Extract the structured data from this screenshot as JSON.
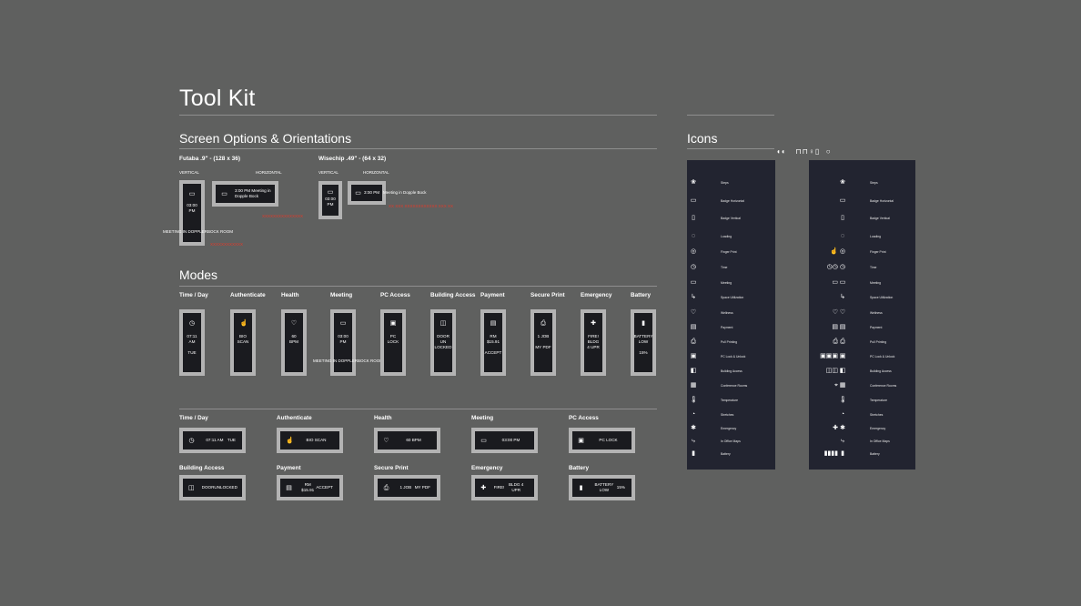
{
  "title": "Tool Kit",
  "screen_options": {
    "heading": "Screen Options & Orientations",
    "futaba": {
      "name": "Futaba .9\" - (128 x 36)",
      "vertical_label": "VERTICAL",
      "horizontal_label": "HORIZONTAL",
      "vertical_text": "03:00 PM",
      "overflow_text": "MEETING IN DOPPLERBOCK ROOM",
      "horizontal_text": "3:00 PM Meeting in Dopple Bock",
      "red_note_v": "XXXXXXXXXXXX",
      "red_note_h": "XXXXXXXXXXXXXXX"
    },
    "wisechip": {
      "name": "Wisechip .49\" - (64 x 32)",
      "vertical_label": "VERTICAL",
      "horizontal_label": "HORIZONTAL",
      "vertical_text": "03:00 PM",
      "horizontal_text": "3:00 PM",
      "overflow_text": "Meeting in Dopple Bock",
      "red_note_h": "XX XXX XXXXXXXXXXXX XXX XX"
    }
  },
  "modes": {
    "heading": "Modes",
    "vertical": [
      {
        "label": "Time / Day",
        "icon": "clock-icon",
        "glyph": "◷",
        "lines": [
          "07:11",
          "AM",
          "",
          "TUE"
        ]
      },
      {
        "label": "Authenticate",
        "icon": "finger-touch-icon",
        "glyph": "☝",
        "lines": [
          "BIO",
          "SCAN"
        ]
      },
      {
        "label": "Health",
        "icon": "heart-pulse-icon",
        "glyph": "♡",
        "lines": [
          "60",
          "BPM"
        ]
      },
      {
        "label": "Meeting",
        "icon": "calendar-icon",
        "glyph": "▭",
        "lines": [
          "03:00",
          "PM"
        ],
        "overflow": "MEETING IN DOPPLERBOCK ROOM"
      },
      {
        "label": "PC Access",
        "icon": "laptop-icon",
        "glyph": "▣",
        "lines": [
          "PC",
          "LOCK"
        ]
      },
      {
        "label": "Building Access",
        "icon": "door-icon",
        "glyph": "◫",
        "lines": [
          "DOOR",
          "UN",
          "LOCKED"
        ]
      },
      {
        "label": "Payment",
        "icon": "card-icon",
        "glyph": "▤",
        "lines": [
          "RM",
          "$15.91",
          "",
          "ACCEPT"
        ]
      },
      {
        "label": "Secure Print",
        "icon": "printer-icon",
        "glyph": "⎙",
        "lines": [
          "1 JOB",
          "",
          "MY PDF"
        ]
      },
      {
        "label": "Emergency",
        "icon": "first-aid-icon",
        "glyph": "✚",
        "lines": [
          "FIRE!",
          "BLDG",
          "4 UPR"
        ]
      },
      {
        "label": "Battery",
        "icon": "battery-icon",
        "glyph": "▮",
        "lines": [
          "BATTERY",
          "LOW",
          "",
          "15%"
        ]
      }
    ],
    "horizontal": [
      {
        "label": "Time / Day",
        "icon": "clock-icon",
        "glyph": "◷",
        "t1": "07:11 AM",
        "t2": "TUE"
      },
      {
        "label": "Authenticate",
        "icon": "finger-touch-icon",
        "glyph": "☝",
        "t1": "BIO SCAN",
        "t2": ""
      },
      {
        "label": "Health",
        "icon": "heart-pulse-icon",
        "glyph": "♡",
        "t1": "60 BPM",
        "t2": ""
      },
      {
        "label": "Meeting",
        "icon": "calendar-icon",
        "glyph": "▭",
        "t1": "03:00 PM",
        "t2": ""
      },
      {
        "label": "PC Access",
        "icon": "laptop-icon",
        "glyph": "▣",
        "t1": "PC LOCK",
        "t2": ""
      },
      {
        "label": "Building Access",
        "icon": "door-icon",
        "glyph": "◫",
        "t1": "DOOR",
        "t2": "UNLOCKED"
      },
      {
        "label": "Payment",
        "icon": "card-icon",
        "glyph": "▤",
        "t1": "RM $15.91",
        "t2": "ACCEPT"
      },
      {
        "label": "Secure Print",
        "icon": "printer-icon",
        "glyph": "⎙",
        "t1": "1 JOB",
        "t2": "MY PDF"
      },
      {
        "label": "Emergency",
        "icon": "first-aid-icon",
        "glyph": "✚",
        "t1": "FIRE!",
        "t2": "BLDG 4 UPR"
      },
      {
        "label": "Battery",
        "icon": "battery-icon",
        "glyph": "▮",
        "t1": "BATTERY LOW",
        "t2": "15%"
      }
    ]
  },
  "icons": {
    "heading": "Icons",
    "rows": [
      {
        "name": "Steps",
        "icon": "footprints-icon",
        "glyph": "❀",
        "alt": ""
      },
      {
        "name": "Badge Horizontal",
        "icon": "badge-horizontal-icon",
        "glyph": "▭",
        "alt": ""
      },
      {
        "name": "Badge Vertical",
        "icon": "badge-vertical-icon",
        "glyph": "▯",
        "alt": ""
      },
      {
        "name": "Loading",
        "icon": "loading-icon",
        "glyph": "◌",
        "alt": ""
      },
      {
        "name": "Finger Print",
        "icon": "fingerprint-icon",
        "glyph": "◎",
        "alt": "☝"
      },
      {
        "name": "Time",
        "icon": "clock-icon",
        "glyph": "◷",
        "alt": "◷◷"
      },
      {
        "name": "Meeting",
        "icon": "calendar-icon",
        "glyph": "▭",
        "alt": "▭"
      },
      {
        "name": "Space Utilization",
        "icon": "space-utilization-icon",
        "glyph": "↳",
        "alt": ""
      },
      {
        "name": "Wellness",
        "icon": "heart-pulse-icon",
        "glyph": "♡",
        "alt": "♡"
      },
      {
        "name": "Payment",
        "icon": "card-icon",
        "glyph": "▤",
        "alt": "▤"
      },
      {
        "name": "Pull Printing",
        "icon": "printer-icon",
        "glyph": "⎙",
        "alt": "⎙"
      },
      {
        "name": "PC Lock & Unlock",
        "icon": "laptop-icon",
        "glyph": "▣",
        "alt": "▣▣▣"
      },
      {
        "name": "Building Access",
        "icon": "door-icon",
        "glyph": "◧",
        "alt": "◫◫"
      },
      {
        "name": "Conference Rooms",
        "icon": "conference-room-icon",
        "glyph": "▦",
        "alt": "⌖"
      },
      {
        "name": "Temperature",
        "icon": "thermometer-icon",
        "glyph": "🌡",
        "alt": ""
      },
      {
        "name": "Stretches",
        "icon": "stopwatch-icon",
        "glyph": "◔",
        "alt": ""
      },
      {
        "name": "Emergency",
        "icon": "first-aid-icon",
        "glyph": "✱",
        "alt": "✚"
      },
      {
        "name": "In Office Maps",
        "icon": "map-route-icon",
        "glyph": "⤷",
        "alt": ""
      },
      {
        "name": "Battery",
        "icon": "battery-icon",
        "glyph": "▮",
        "alt": "▮▮▮▮"
      }
    ]
  },
  "colors": {
    "background": "#5f605f",
    "frame": "#b3b3b3",
    "screen": "#1a1b1f",
    "panel": "#222430",
    "note": "#e23a2a"
  }
}
